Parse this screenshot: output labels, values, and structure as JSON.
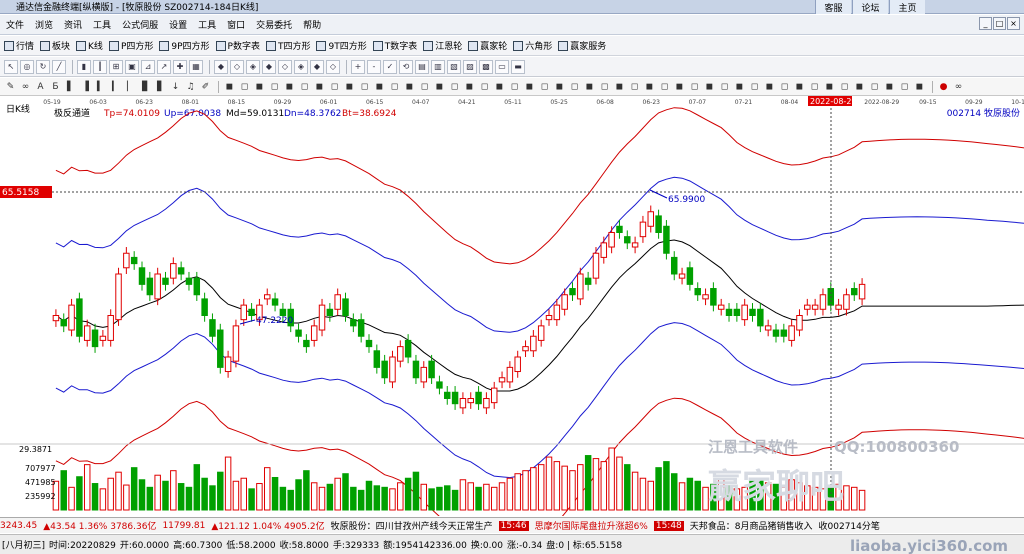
{
  "app": {
    "title": "通达信金融终端[纵横版] - [牧原股份 SZ002714-184日K线]",
    "buttons": [
      "客服",
      "论坛",
      "主页"
    ]
  },
  "menu": [
    "文件",
    "浏览",
    "资讯",
    "工具",
    "公式伺服",
    "设置",
    "工具",
    "窗口",
    "交易委托",
    "帮助"
  ],
  "toolbar": [
    {
      "icon": "grid-icon",
      "label": "行情"
    },
    {
      "icon": "board-icon",
      "label": "板块"
    },
    {
      "icon": "kline-icon",
      "label": "K线"
    },
    {
      "icon": "p-icon",
      "label": "P四方形"
    },
    {
      "icon": "9p-icon",
      "label": "9P四方形"
    },
    {
      "icon": "p-icon",
      "label": "P数字表"
    },
    {
      "icon": "t-icon",
      "label": "T四方形"
    },
    {
      "icon": "9t-icon",
      "label": "9T四方形"
    },
    {
      "icon": "t-icon",
      "label": "T数字表"
    },
    {
      "icon": "circle-icon",
      "label": "江恩轮"
    },
    {
      "icon": "circle-icon",
      "label": "赢家轮"
    },
    {
      "icon": "star-icon",
      "label": "六角形"
    },
    {
      "icon": "service-icon",
      "label": "赢家服务"
    }
  ],
  "chart_data": {
    "type": "candlestick",
    "period_label": "日K线",
    "indicator": {
      "name": "极反通道",
      "Tp": "Tp=74.0109",
      "Up": "Up=67.0038",
      "Md": "Md=59.0131",
      "Dn": "Dn=48.3762",
      "Bt": "Bt=38.6924"
    },
    "stock": "002714 牧原股份",
    "dates": [
      "05-19",
      "06-03",
      "06-23",
      "08-01",
      "08-15",
      "09-29",
      "06-01",
      "06-15",
      "04-07",
      "04-21",
      "05-11",
      "05-25",
      "06-08",
      "06-23",
      "07-07",
      "07-21",
      "08-04",
      "08-16",
      "2022-08-29",
      "09-15",
      "09-29",
      "10-13"
    ],
    "cursor_date": "2022-08-29",
    "price_marker": "65.5158",
    "high_label": "65.9900",
    "low_label": "47.2220",
    "price_range": [
      44,
      76
    ],
    "closes": [
      56,
      55,
      57,
      54,
      55,
      53,
      54,
      56,
      60,
      62,
      61,
      59,
      58,
      60,
      59,
      61,
      60,
      59,
      58,
      56,
      54,
      51,
      52,
      55,
      57,
      56,
      57,
      58,
      57,
      56,
      55,
      54,
      53,
      55,
      57,
      56,
      58,
      56,
      55,
      54,
      53,
      51,
      50,
      52,
      53,
      52,
      50,
      51,
      50,
      49,
      48,
      47.5,
      48,
      48,
      47.5,
      48,
      49,
      50,
      51,
      52,
      53,
      54,
      55,
      56,
      57,
      58,
      58,
      60,
      59,
      62,
      63,
      64,
      64,
      63,
      63,
      65,
      66,
      64,
      62,
      60,
      60,
      59,
      58,
      58,
      57,
      57,
      56,
      56,
      57,
      56,
      55,
      55,
      54,
      54,
      55,
      56,
      57,
      57,
      58,
      57,
      57,
      58,
      58,
      59
    ],
    "volume_ticks": [
      "707977",
      "471985",
      "235992"
    ],
    "vol_range": [
      0,
      900000
    ],
    "volumes": [
      380,
      520,
      300,
      440,
      600,
      350,
      280,
      420,
      500,
      330,
      560,
      400,
      300,
      460,
      380,
      520,
      350,
      300,
      600,
      420,
      320,
      500,
      700,
      380,
      420,
      280,
      350,
      560,
      430,
      300,
      260,
      400,
      520,
      360,
      300,
      340,
      420,
      480,
      300,
      260,
      380,
      320,
      300,
      280,
      360,
      420,
      500,
      340,
      280,
      300,
      320,
      260,
      400,
      360,
      300,
      340,
      300,
      360,
      420,
      480,
      520,
      560,
      600,
      700,
      640,
      580,
      520,
      600,
      720,
      680,
      640,
      820,
      700,
      600,
      500,
      420,
      380,
      560,
      640,
      480,
      360,
      420,
      380,
      300,
      340,
      400,
      320,
      280,
      300,
      380,
      420,
      360,
      340,
      300,
      400,
      360,
      320,
      300,
      280,
      300,
      340,
      320,
      300,
      260
    ]
  },
  "watermarks": {
    "brand": "江恩工具软件",
    "qq": "QQ:100800360",
    "big": "赢家聊吧",
    "site": "liaoba.yici360.com"
  },
  "status1": [
    {
      "t": "3243.45",
      "c": "red"
    },
    {
      "t": "▲43.54 1.36% 3786.36亿",
      "c": "red"
    },
    {
      "t": "11799.81",
      "c": "red"
    },
    {
      "t": "▲121.12 1.04% 4905.2亿",
      "c": "red"
    },
    {
      "t": "牧原股份：四川甘孜州产线今天正常生产",
      "c": "black"
    },
    {
      "t": "15:46",
      "c": "white"
    },
    {
      "t": "思摩尔国际尾盘拉升涨超6%",
      "c": "red"
    },
    {
      "t": "15:48",
      "c": "white"
    },
    {
      "t": "天邦食品：8月商品猪销售收入",
      "c": "black"
    },
    {
      "t": "收002714分笔",
      "c": "black"
    }
  ],
  "status2": {
    "date": "[八月初三]",
    "time": "时间:20220829",
    "open": "开:60.0000",
    "high": "高:60.7300",
    "low": "低:58.2000",
    "close": "收:58.8000",
    "hands": "手:329333",
    "amount": "额:1954142336.00",
    "turn": "换:0.00",
    "chg": "涨:-0.34",
    "sz": "盘:0 | 标:65.5158"
  }
}
